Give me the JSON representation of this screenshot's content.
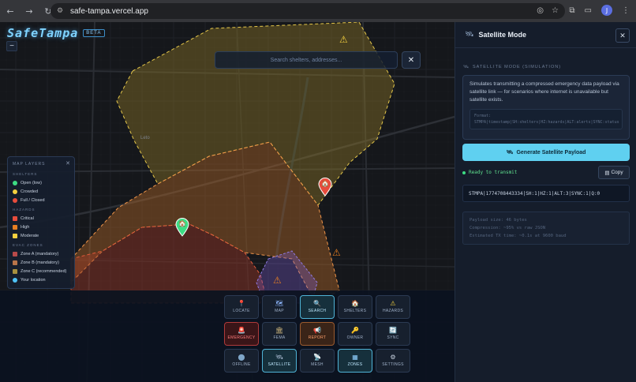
{
  "browser": {
    "url": "safe-tampa.vercel.app",
    "avatar_letter": "J"
  },
  "app": {
    "logo": "SafeTampa",
    "badge": "BETA",
    "zoom_out": "−"
  },
  "search": {
    "placeholder": "Search shelters, addresses...",
    "close": "✕"
  },
  "map": {
    "place_label": "Leto"
  },
  "legend": {
    "title": "MAP LAYERS",
    "close": "✕",
    "sections": [
      {
        "title": "SHELTERS",
        "items": [
          {
            "label": "Open (low)",
            "color": "#3ddc84",
            "shape": "dot"
          },
          {
            "label": "Crowded",
            "color": "#f4d03f",
            "shape": "dot"
          },
          {
            "label": "Full / Closed",
            "color": "#e74c3c",
            "shape": "dot"
          }
        ]
      },
      {
        "title": "HAZARDS",
        "items": [
          {
            "label": "Critical",
            "color": "#e74c3c",
            "shape": "sq"
          },
          {
            "label": "High",
            "color": "#e67e22",
            "shape": "sq"
          },
          {
            "label": "Moderate",
            "color": "#f4d03f",
            "shape": "sq"
          }
        ]
      },
      {
        "title": "EVAC ZONES",
        "items": [
          {
            "label": "Zone A (mandatory)",
            "color": "#b84a4a",
            "shape": "sq"
          },
          {
            "label": "Zone B (mandatory)",
            "color": "#b8744a",
            "shape": "sq"
          },
          {
            "label": "Zone C (recommended)",
            "color": "#a8903e",
            "shape": "sq"
          },
          {
            "label": "Your location",
            "color": "#4fc3f7",
            "shape": "dot"
          }
        ]
      }
    ]
  },
  "toolbar": {
    "rows": [
      [
        {
          "label": "LOCATE",
          "icon": "📍",
          "icon_name": "pin-icon",
          "state": ""
        },
        {
          "label": "MAP",
          "icon": "🗺",
          "icon_name": "map-icon",
          "state": ""
        },
        {
          "label": "SEARCH",
          "icon": "🔍",
          "icon_name": "search-icon",
          "state": "active"
        },
        {
          "label": "SHELTERS",
          "icon": "🏠",
          "icon_name": "house-icon",
          "state": ""
        },
        {
          "label": "HAZARDS",
          "icon": "⚠",
          "icon_name": "warning-icon",
          "state": ""
        }
      ],
      [
        {
          "label": "EMERGENCY",
          "icon": "🚨",
          "icon_name": "siren-icon",
          "state": "danger"
        },
        {
          "label": "FEMA",
          "icon": "🏛",
          "icon_name": "building-icon",
          "state": ""
        },
        {
          "label": "REPORT",
          "icon": "📢",
          "icon_name": "megaphone-icon",
          "state": "warnb"
        },
        {
          "label": "OWNER",
          "icon": "🔑",
          "icon_name": "key-icon",
          "state": ""
        },
        {
          "label": "SYNC",
          "icon": "🔄",
          "icon_name": "sync-icon",
          "state": ""
        }
      ],
      [
        {
          "label": "OFFLINE",
          "icon": "⬤",
          "icon_name": "offline-icon",
          "state": ""
        },
        {
          "label": "SATELLITE",
          "icon": "🛰",
          "icon_name": "satellite-icon",
          "state": "active"
        },
        {
          "label": "MESH",
          "icon": "📡",
          "icon_name": "antenna-icon",
          "state": ""
        },
        {
          "label": "ZONES",
          "icon": "▦",
          "icon_name": "zones-icon",
          "state": "active"
        },
        {
          "label": "SETTINGS",
          "icon": "⚙",
          "icon_name": "gear-icon",
          "state": ""
        }
      ]
    ]
  },
  "panel": {
    "title": "Satellite Mode",
    "close": "✕",
    "section_title": "SATELLITE MODE (SIMULATION)",
    "description": "Simulates transmitting a compressed emergency data payload via satellite link — for scenarios where internet is unavailable but satellite exists.",
    "format_label": "Format:",
    "format_value": "STMPA|timestamp|SH:shelters|HZ:hazards|ALT:alerts|SYNC:status",
    "generate_label": "Generate Satellite Payload",
    "status": "Ready to transmit",
    "copy_label": "Copy",
    "payload": "STMPA|1774708443334|SH:1|HZ:1|ALT:3|SYNC:1|Q:0",
    "stats": [
      "Payload size: 46 bytes",
      "Compression: ~95% vs raw JSON",
      "Estimated TX time: ~0.1s at 9600 baud"
    ]
  }
}
